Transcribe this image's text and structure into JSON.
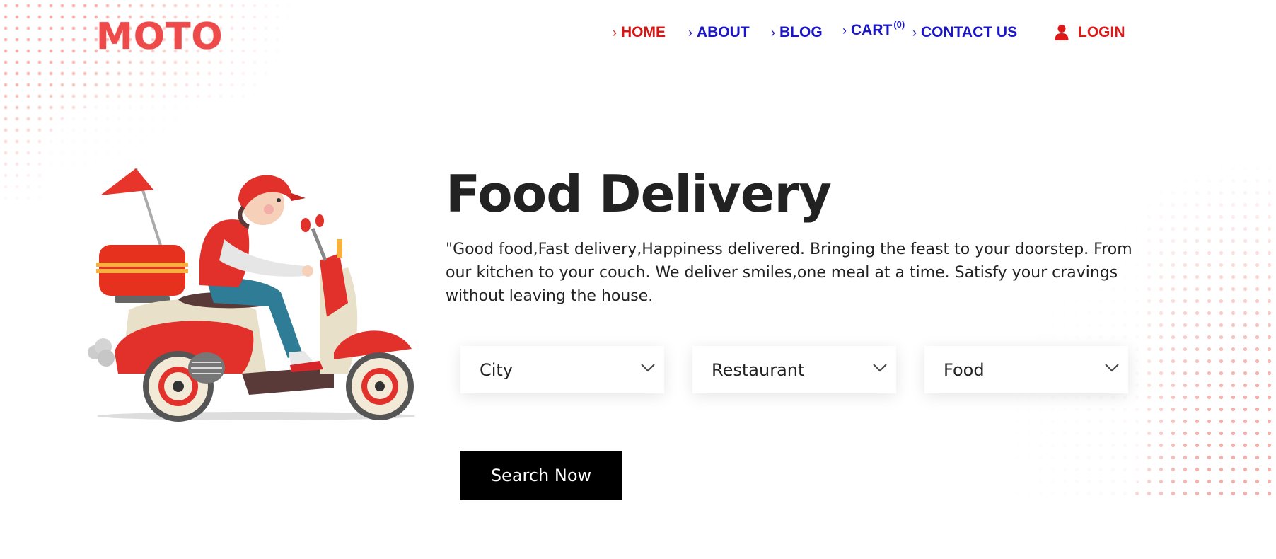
{
  "brand": {
    "logo": "MOTO",
    "color": "#ef4a4a"
  },
  "nav": {
    "items": [
      {
        "label": "HOME",
        "active": true
      },
      {
        "label": "ABOUT"
      },
      {
        "label": "BLOG"
      },
      {
        "label": "CART",
        "count": "(0)"
      },
      {
        "label": "CONTACT US"
      }
    ],
    "login_label": "LOGIN",
    "login_icon": "user-icon",
    "chevron_icon": "chevron-right-icon",
    "link_color": "#1a15c8",
    "active_color": "#d81414"
  },
  "hero": {
    "title": "Food Delivery",
    "tagline": "\"Good food,Fast delivery,Happiness delivered. Bringing the feast to your doorstep. From our kitchen to your couch. We deliver smiles,one meal at a time. Satisfy your cravings without leaving the house.",
    "illustration": "delivery-scooter-illustration"
  },
  "filters": [
    {
      "label": "City",
      "icon": "chevron-down-icon"
    },
    {
      "label": "Restaurant",
      "icon": "chevron-down-icon"
    },
    {
      "label": "Food",
      "icon": "chevron-down-icon"
    }
  ],
  "search_button": {
    "label": "Search Now",
    "bg": "#000000",
    "fg": "#ffffff"
  }
}
